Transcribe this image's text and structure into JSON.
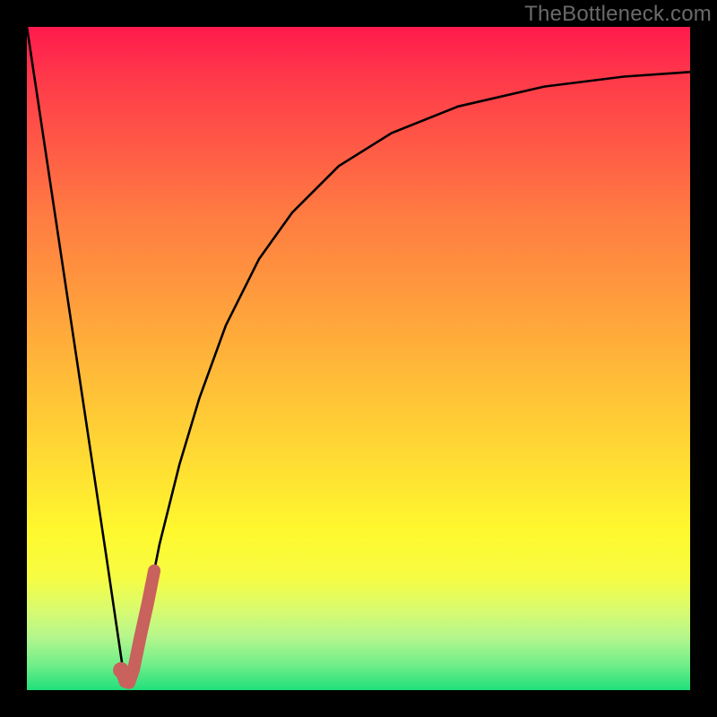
{
  "watermark": "TheBottleneck.com",
  "colors": {
    "frame": "#000000",
    "gradient_stops": [
      "#ff1a4d",
      "#ff3a4a",
      "#ff5a46",
      "#ff7a42",
      "#ff943e",
      "#ffaf3a",
      "#ffc936",
      "#ffe332",
      "#fff82e",
      "#f6fc42",
      "#d8fb70",
      "#b4f68c",
      "#74ef8a",
      "#1fe07a"
    ],
    "curve": "#000000",
    "highlight": "#c9615d"
  },
  "chart_data": {
    "type": "line",
    "title": "",
    "xlabel": "",
    "ylabel": "",
    "xlim": [
      0,
      100
    ],
    "ylim": [
      0,
      100
    ],
    "grid": false,
    "legend": false,
    "series": [
      {
        "name": "bottleneck-curve",
        "x": [
          0,
          3,
          6,
          9,
          12,
          14.5,
          15,
          16,
          18,
          20,
          23,
          26,
          30,
          35,
          40,
          47,
          55,
          65,
          78,
          90,
          100
        ],
        "y": [
          100,
          80,
          60,
          40,
          20,
          3,
          1,
          3,
          12,
          22,
          34,
          44,
          55,
          65,
          72,
          79,
          84,
          88,
          91,
          92.5,
          93.2
        ]
      },
      {
        "name": "highlight-segment",
        "x": [
          14.2,
          14.8,
          15.4,
          16.1,
          17.1,
          18.2,
          19.2
        ],
        "y": [
          3.0,
          1.3,
          1.1,
          3.1,
          8.0,
          13.0,
          18.0
        ]
      }
    ],
    "annotations": []
  }
}
